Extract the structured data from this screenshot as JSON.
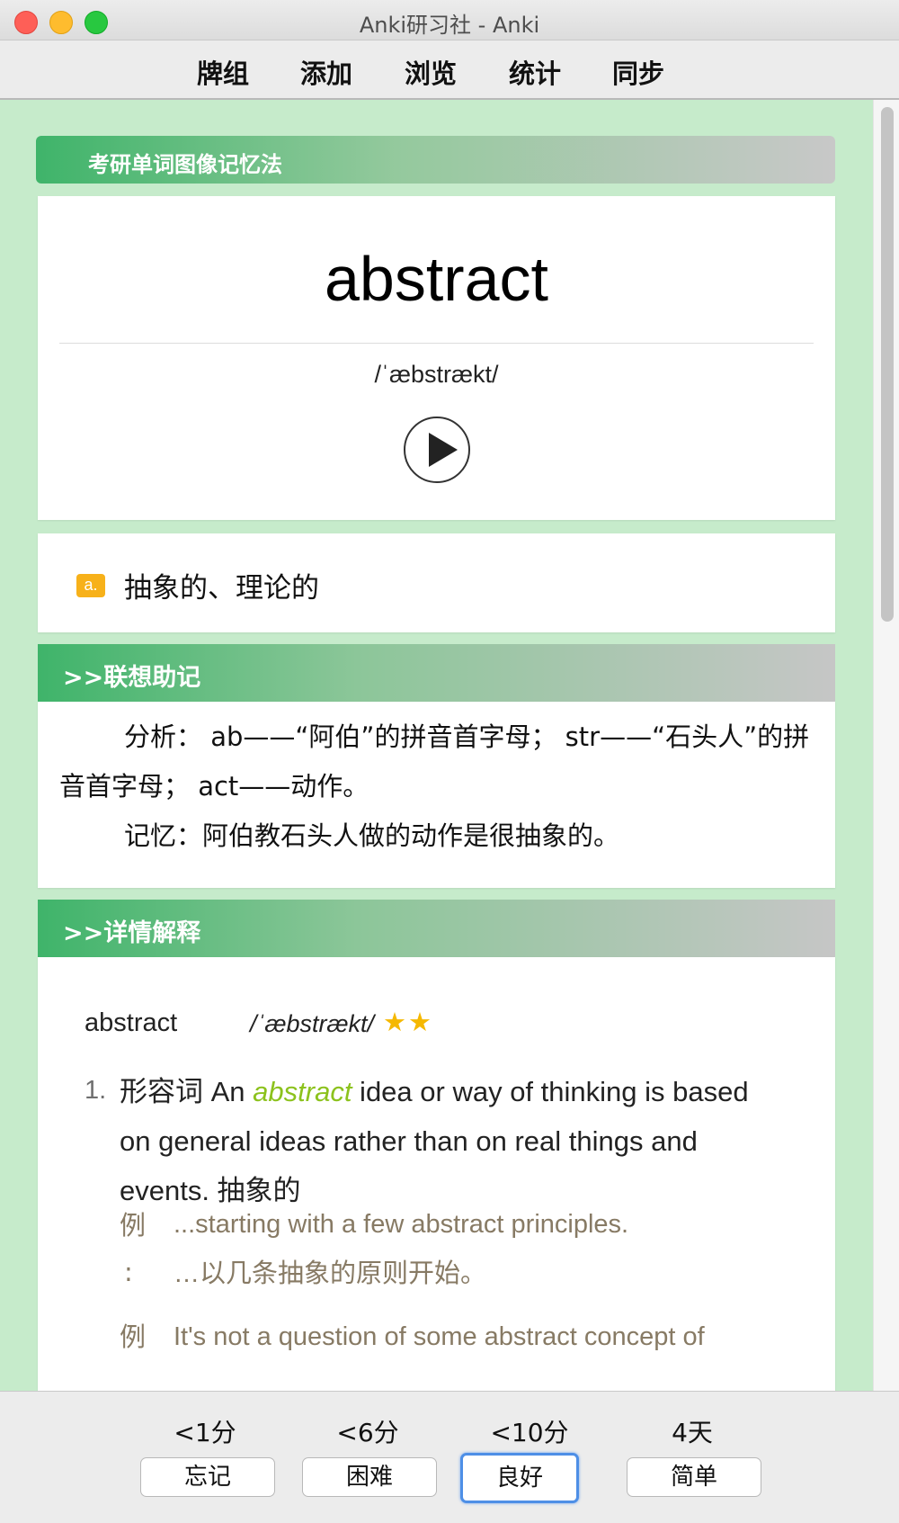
{
  "window": {
    "title": "Anki研习社 - Anki"
  },
  "toolbar": {
    "items": [
      "牌组",
      "添加",
      "浏览",
      "统计",
      "同步"
    ]
  },
  "card": {
    "deck_banner": "考研单词图像记忆法",
    "word": "abstract",
    "phonetic": "/ˈæbstrækt/",
    "pos": "a.",
    "definition": "抽象的、理论的",
    "mnemonic_header": ">>联想助记",
    "mnemonic_lines": [
      "分析： ab——“阿伯”的拼音首字母； str——“石头人”的拼音首字母； act——动作。",
      "记忆：阿伯教石头人做的动作是很抽象的。"
    ],
    "detail_header": ">>详情解释",
    "detail": {
      "headword": "abstract",
      "phonetic": "/ˈæbstrækt/",
      "stars": "★★",
      "sense_number": "1.",
      "sense_pre": "形容词 An ",
      "sense_highlight": "abstract",
      "sense_post": " idea or way of thinking is based on general ideas rather than on real things and events. 抽象的",
      "example_label": "例",
      "example_colon": ":",
      "example1_en": "...starting with a few abstract principles.",
      "example1_zh": "…以几条抽象的原则开始。",
      "example2_en": "It's not a question of some abstract concept of"
    }
  },
  "answer_bar": {
    "intervals": [
      "<1分",
      "<6分",
      "<10分",
      "4天"
    ],
    "buttons": [
      "忘记",
      "困难",
      "良好",
      "简单"
    ]
  },
  "colors": {
    "accent_green": "#3fb46a",
    "highlight": "#8cc21d",
    "badge": "#f7b11a",
    "star": "#f5b800",
    "example": "#877a64"
  }
}
